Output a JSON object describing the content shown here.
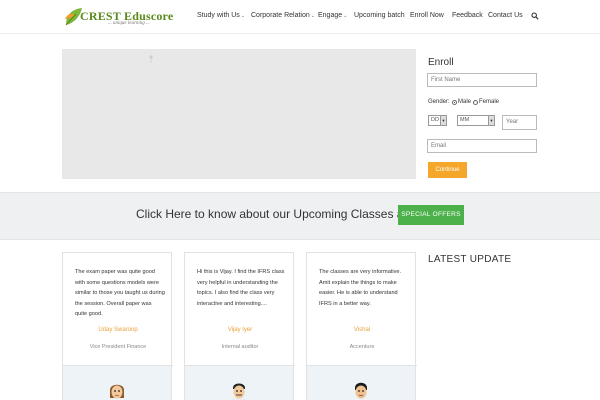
{
  "brand": {
    "name": "CREST Eduscore",
    "tagline": "... unique learning ..."
  },
  "nav": {
    "items": [
      {
        "label": "Study with Us",
        "caret": "⌄"
      },
      {
        "label": "Corporate Relation",
        "caret": "⌄"
      },
      {
        "label": "Engage",
        "caret": "⌄"
      },
      {
        "label": "Upcoming batch",
        "caret": ""
      },
      {
        "label": "Enroll Now",
        "caret": ""
      },
      {
        "label": "Feedback",
        "caret": ""
      },
      {
        "label": "Contact Us",
        "caret": ""
      }
    ],
    "search_icon": "search-icon"
  },
  "enroll": {
    "title": "Enroll",
    "first_name_placeholder": "First Name",
    "gender_label": "Gender:",
    "gender_options": [
      "Male",
      "Female"
    ],
    "gender_selected": "Male",
    "day_value": "DD",
    "month_value": "MM",
    "year_placeholder": "Year",
    "email_placeholder": "Email",
    "continue_label": "Continue"
  },
  "offer": {
    "text": "Click Here to know about our Upcoming Classes and",
    "button_label": "SPECIAL OFFERS"
  },
  "testimonials": [
    {
      "text": "The exam paper was quite good with some questions models were similar to those you taught us during the session. Overall paper was quite good.",
      "name": "Uday Swaroop",
      "role": "Vice President Finance"
    },
    {
      "text": "Hi this is Vijay. I find the IFRS class very helpful in understanding the topics. I also find the class very interactive and interesting....",
      "name": "Vijay Iyer",
      "role": "Internal auditor"
    },
    {
      "text": "The classes are very informative. Amit explain the things to make easier. He is able to understand IFRS in a better way.",
      "name": "Vishal",
      "role": "Accenture"
    }
  ],
  "latest": {
    "title": "LATEST UPDATE"
  },
  "colors": {
    "accent_orange": "#f4a72a",
    "accent_green": "#4cb14a",
    "name_orange": "#e8a23c",
    "brand_green": "#5a8a1e"
  }
}
